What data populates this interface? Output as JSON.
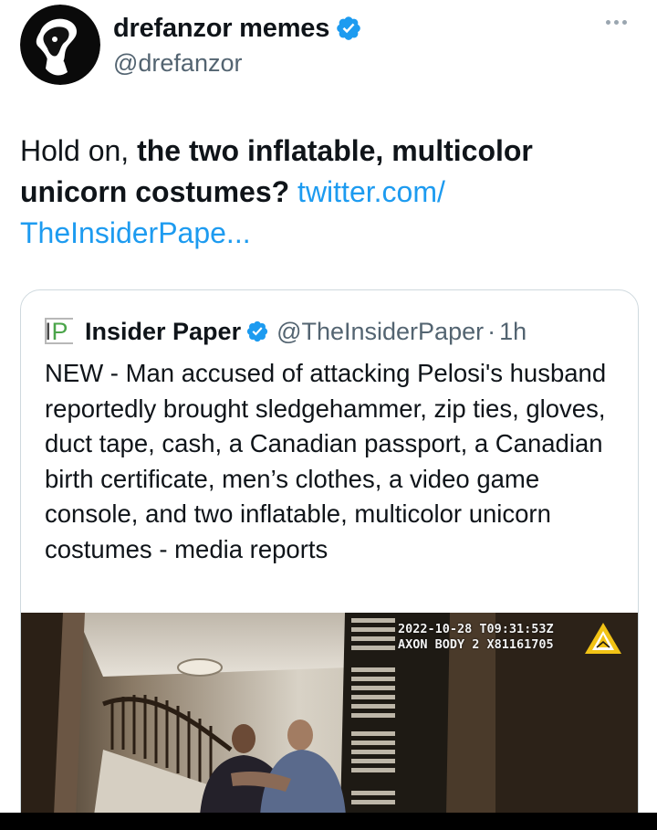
{
  "author": {
    "display_name": "drefanzor memes",
    "handle": "@drefanzor"
  },
  "tweet": {
    "text_plain_1": "Hold on, ",
    "text_bold": "the two inflatable, multicolor unicorn costumes?",
    "text_link": "twitter.com/ TheInsiderPape..."
  },
  "quote": {
    "logo_text_i": "I",
    "logo_text_p": "P",
    "name": "Insider Paper",
    "handle": "@TheInsiderPaper",
    "separator": "·",
    "time": "1h",
    "text": "NEW - Man accused of attacking Pelosi's husband reportedly brought sledgehammer, zip ties, gloves, duct tape, cash, a Canadian passport, a Canadian birth certificate, men’s clothes, a video game console, and two inflatable, multicolor unicorn costumes - media reports",
    "media": {
      "timestamp_line1": "2022-10-28 T09:31:53Z",
      "timestamp_line2": "AXON BODY 2 X81161705"
    }
  },
  "icons": {
    "verified": "verified-badge-icon",
    "more": "more-options-icon",
    "axon": "axon-logo-icon"
  },
  "colors": {
    "link": "#1d9bf0",
    "verified": "#1d9bf0",
    "secondary_text": "#536471"
  }
}
